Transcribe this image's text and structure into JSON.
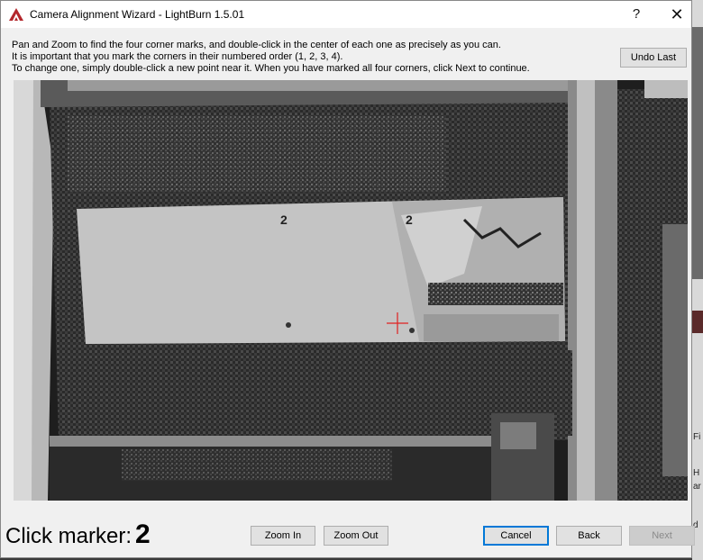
{
  "window": {
    "title": "Camera Alignment Wizard - LightBurn 1.5.01",
    "help_label": "?",
    "close_label": "✕"
  },
  "instructions": [
    "Pan and Zoom to find the four corner marks, and double-click in the center of each one as precisely as you can.",
    "It is important that you mark the corners in their numbered order (1, 2, 3, 4).",
    "To change one, simply double-click a new point near it.  When you have marked all four corners, click Next to continue."
  ],
  "buttons": {
    "undo_last": "Undo Last",
    "zoom_in": "Zoom In",
    "zoom_out": "Zoom Out",
    "cancel": "Cancel",
    "back": "Back",
    "next": "Next"
  },
  "status": {
    "click_marker_label": "Click marker:",
    "click_marker_number": "2"
  },
  "camera_view": {
    "corner_labels": [
      "2",
      "2"
    ],
    "crosshair_color": "#e02020"
  },
  "background_app": {
    "fragments": [
      "Fi",
      "H",
      "ar",
      "d"
    ]
  }
}
